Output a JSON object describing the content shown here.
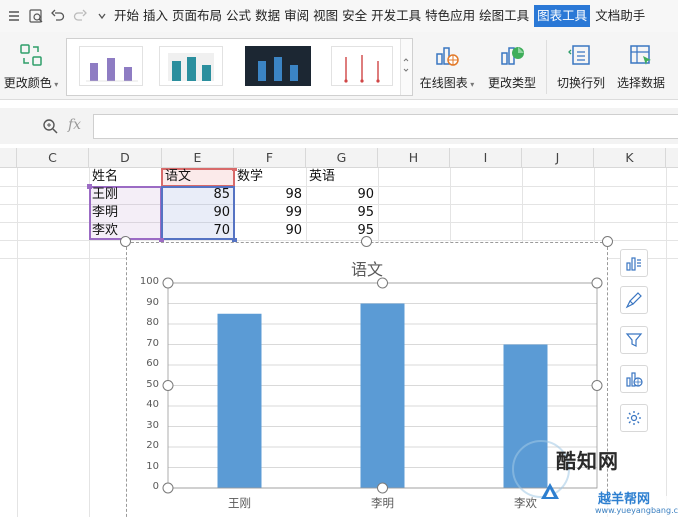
{
  "menu": {
    "tabs": [
      "开始",
      "插入",
      "页面布局",
      "公式",
      "数据",
      "审阅",
      "视图",
      "安全",
      "开发工具",
      "特色应用",
      "绘图工具",
      "图表工具",
      "文档助手"
    ],
    "active_tab": "图表工具"
  },
  "ribbon": {
    "change_color": "更改颜色",
    "online_chart": "在线图表",
    "change_type": "更改类型",
    "switch_row_col": "切换行列",
    "select_data": "选择数据"
  },
  "formula_bar": {
    "fx": "fx",
    "value": ""
  },
  "columns": [
    "C",
    "D",
    "E",
    "F",
    "G",
    "H",
    "I",
    "J",
    "K"
  ],
  "table": {
    "headers": [
      "姓名",
      "语文",
      "数学",
      "英语"
    ],
    "rows": [
      [
        "王刚",
        "85",
        "98",
        "90"
      ],
      [
        "李明",
        "90",
        "99",
        "95"
      ],
      [
        "李欢",
        "70",
        "90",
        "95"
      ]
    ]
  },
  "chart_data": {
    "type": "bar",
    "title": "语文",
    "categories": [
      "王刚",
      "李明",
      "李欢"
    ],
    "values": [
      85,
      90,
      70
    ],
    "xlabel": "",
    "ylabel": "",
    "ylim": [
      0,
      100
    ],
    "yticks": [
      "100",
      "90",
      "80",
      "70",
      "60",
      "50",
      "40",
      "30",
      "20",
      "10",
      "0"
    ],
    "grid": true,
    "legend": "none",
    "bar_color": "#5b9bd5"
  },
  "side_tools": [
    "chart-elements-icon",
    "chart-style-icon",
    "chart-filter-icon",
    "online-chart-icon",
    "settings-icon"
  ],
  "watermark": {
    "text": "酷知网",
    "sub": "越羊帮网",
    "url": "www.yueyangbang.com"
  },
  "colors": {
    "accent": "#2a78d6",
    "bar": "#5b9bd5"
  }
}
